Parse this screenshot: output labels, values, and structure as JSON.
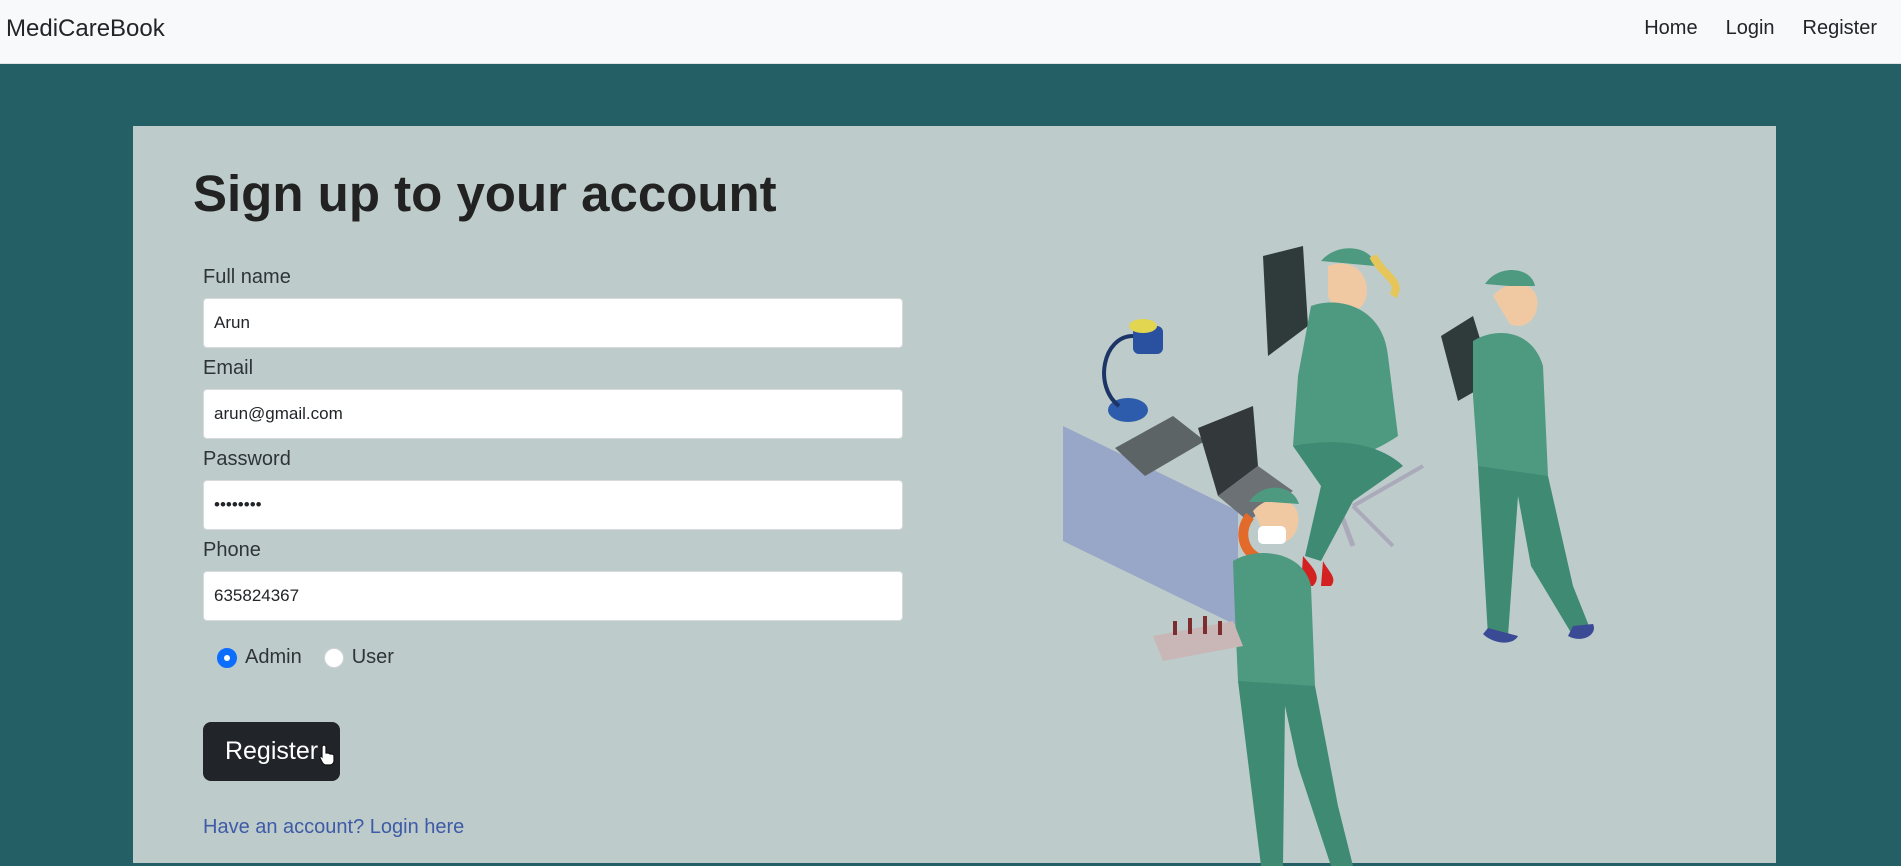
{
  "nav": {
    "brand": "MediCareBook",
    "links": [
      "Home",
      "Login",
      "Register"
    ]
  },
  "form": {
    "title": "Sign up to your account",
    "fields": [
      {
        "label": "Full name",
        "value": "Arun"
      },
      {
        "label": "Email",
        "value": "arun@gmail.com"
      },
      {
        "label": "Password",
        "value": "••••••••"
      },
      {
        "label": "Phone",
        "value": "635824367"
      }
    ],
    "roles": [
      {
        "label": "Admin",
        "checked": true
      },
      {
        "label": "User",
        "checked": false
      }
    ],
    "submit_label": "Register",
    "login_link": "Have an account? Login here"
  },
  "colors": {
    "page_background": "#255f66",
    "card_background": "#bdcccb",
    "button": "#212529",
    "radio_checked": "#0d6efd",
    "link": "#3f5aa6",
    "scrubs": "#4e9a80"
  },
  "illustration": "medical-staff-illustration"
}
